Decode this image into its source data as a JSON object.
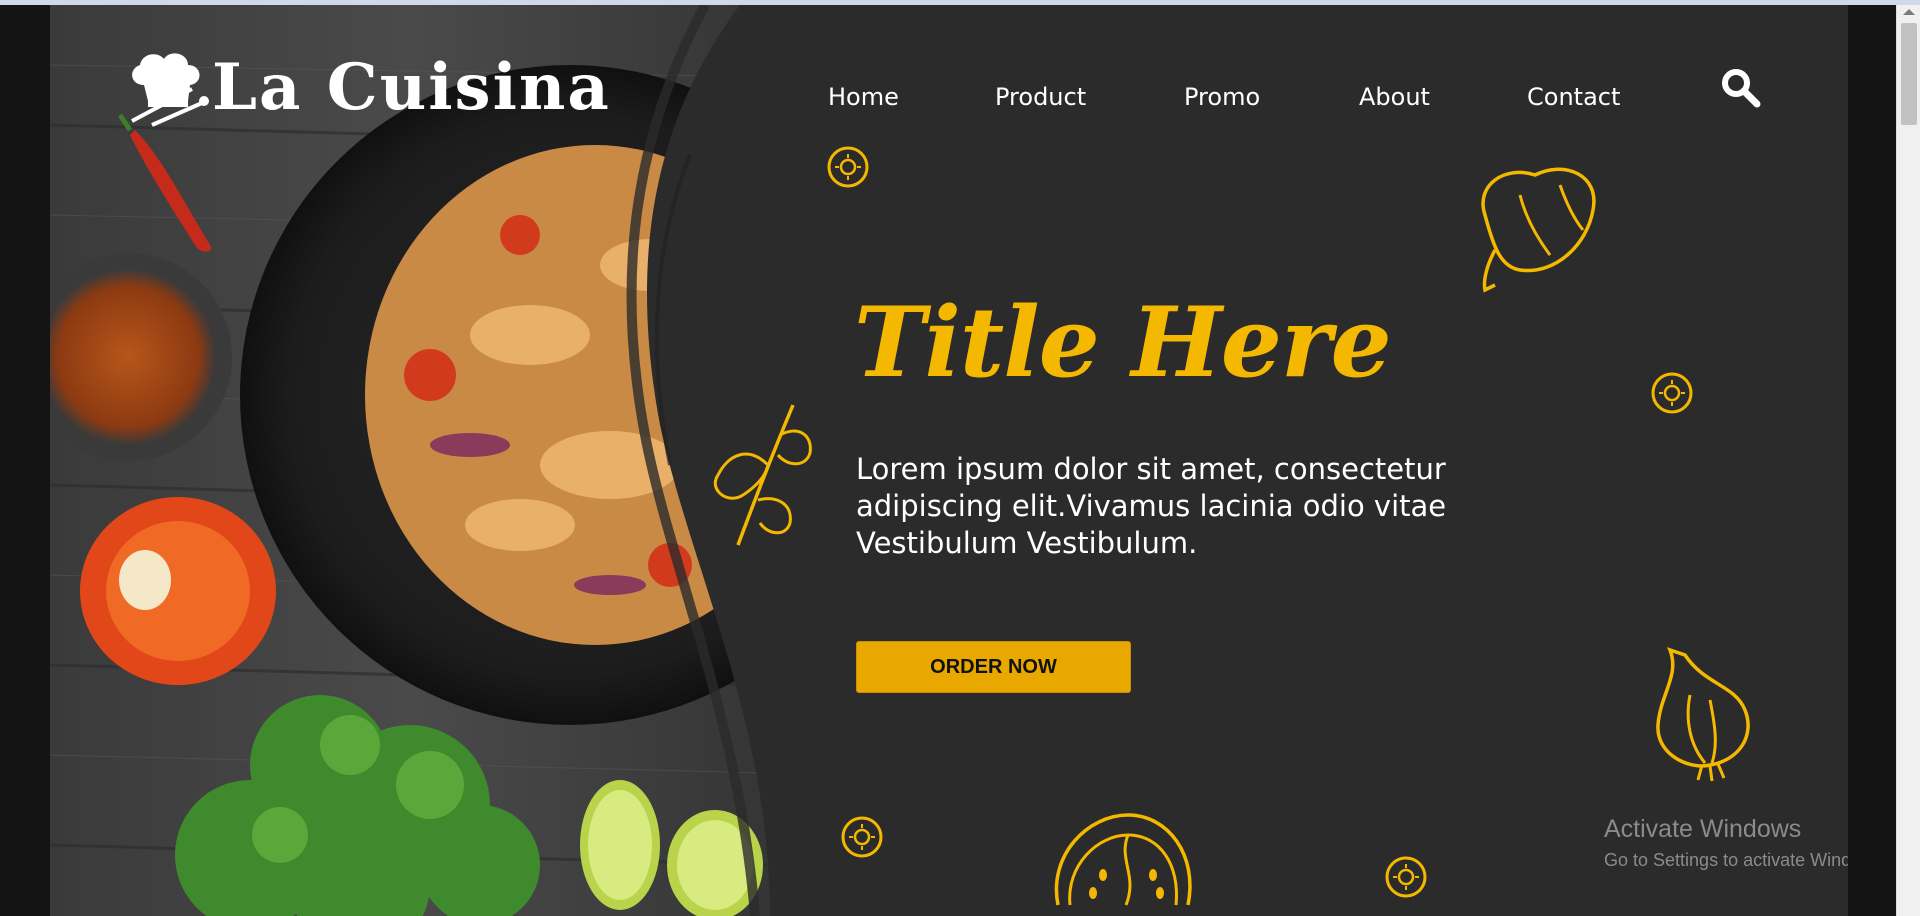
{
  "brand": {
    "name": "La Cuisina"
  },
  "nav": {
    "items": [
      {
        "label": "Home"
      },
      {
        "label": "Product"
      },
      {
        "label": "Promo"
      },
      {
        "label": "About"
      },
      {
        "label": "Contact"
      }
    ]
  },
  "hero": {
    "title": "Title Here",
    "body": "Lorem ipsum dolor sit amet, consectetur adipiscing elit.Vivamus lacinia odio vitae Vestibulum Vestibulum.",
    "cta_label": "ORDER NOW"
  },
  "windows_watermark": {
    "title": "Activate Windows",
    "subtitle": "Go to Settings to activate Windows."
  },
  "colors": {
    "accent": "#f5b800",
    "button": "#e8a800",
    "background": "#2b2b2b",
    "text": "#ffffff"
  },
  "icons": [
    "chef-hat-logo-icon",
    "search-icon",
    "sun-doodle-icon",
    "pepper-doodle-icon",
    "parsley-doodle-icon",
    "garlic-doodle-icon",
    "tomato-doodle-icon"
  ]
}
